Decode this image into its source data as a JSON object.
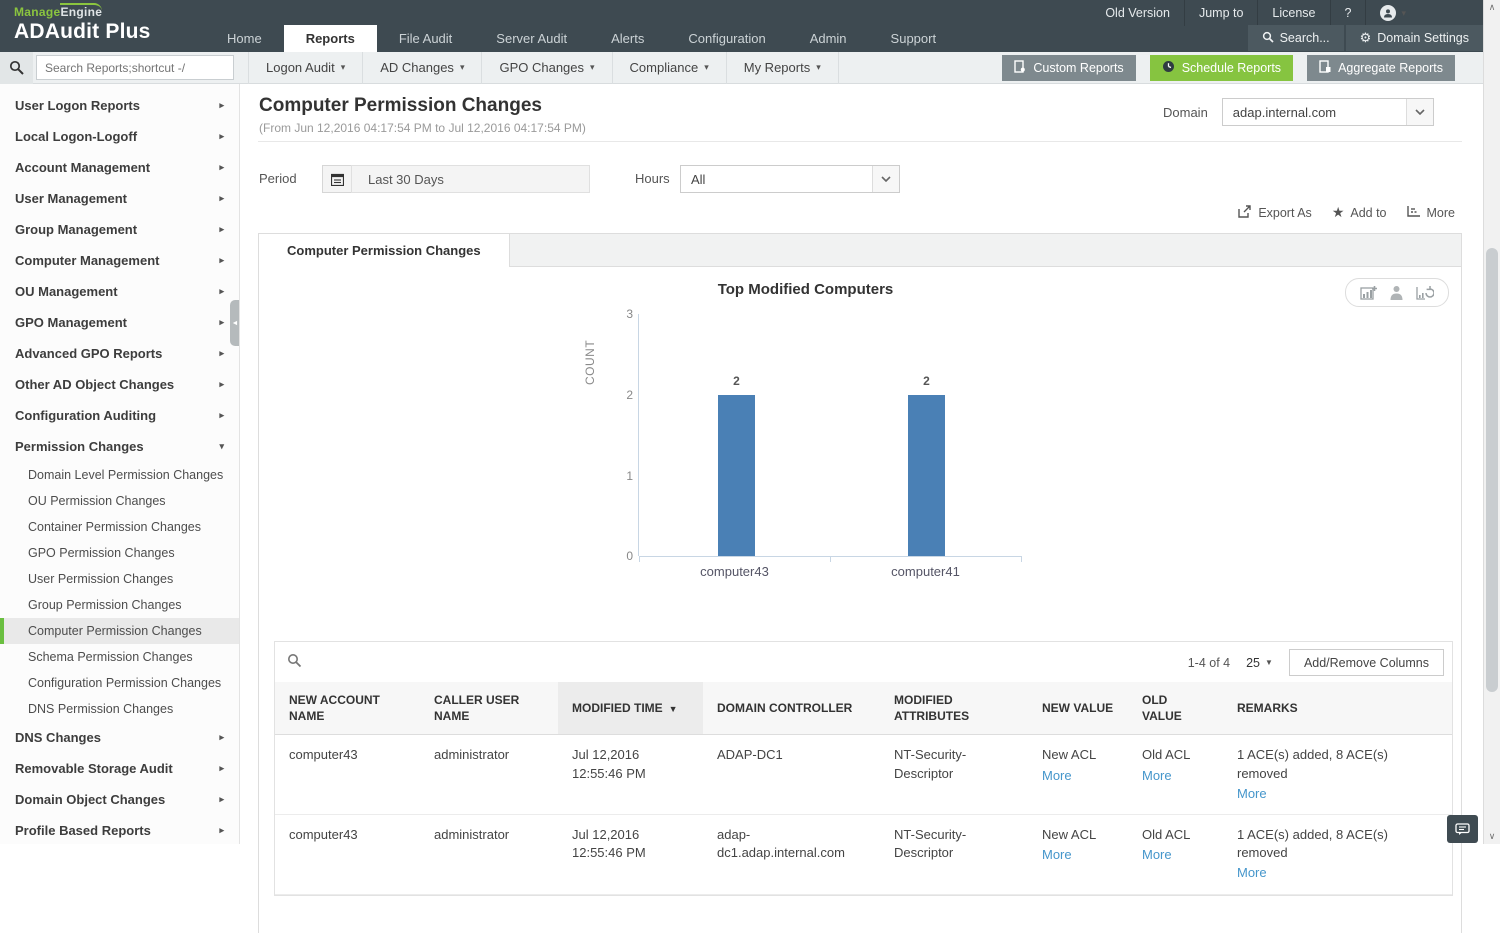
{
  "colors": {
    "header_bg": "#3e4a51",
    "accent_green": "#8bc53f",
    "button_green": "#86c440",
    "button_gray": "#7e898e",
    "bar_blue": "#4a80b5",
    "link_blue": "#4596cb",
    "selected_green": "#6abf40"
  },
  "icons": {
    "search": "magnifier-svg",
    "calendar": "calendar-svg",
    "gear": "⚙",
    "help": "?",
    "user": "person-svg",
    "clock": "clock-svg",
    "report_doc": "doc-svg",
    "export": "export-svg",
    "star": "★",
    "more_lines": "list-svg",
    "chart_add": "bars-plus-svg",
    "chart_person": "person-svg",
    "chart_refresh": "refresh-svg",
    "chat": "chat-bubble-svg",
    "caret_down": "▾",
    "arrow_right": "▸",
    "sort_desc": "▼",
    "scroll_up": "∧",
    "scroll_down": "∨",
    "collapse_left": "◄"
  },
  "header": {
    "brand_manage": "Manage",
    "brand_engine": "Engine",
    "product": "ADAudit Plus",
    "nav": [
      "Home",
      "Reports",
      "File Audit",
      "Server Audit",
      "Alerts",
      "Configuration",
      "Admin",
      "Support"
    ],
    "utility": [
      "Old Version",
      "Jump to",
      "License"
    ],
    "help": "?",
    "search_label": "Search...",
    "domain_settings_label": "Domain Settings"
  },
  "toolbar": {
    "search_placeholder": "Search Reports;shortcut -/",
    "menus": [
      "Logon Audit",
      "AD Changes",
      "GPO Changes",
      "Compliance",
      "My Reports"
    ],
    "buttons": [
      "Custom Reports",
      "Schedule Reports",
      "Aggregate Reports"
    ]
  },
  "sidebar": {
    "top_items": [
      "User Logon Reports",
      "Local Logon-Logoff",
      "Account Management",
      "User Management",
      "Group Management",
      "Computer Management",
      "OU Management",
      "GPO Management",
      "Advanced GPO Reports",
      "Other AD Object Changes",
      "Configuration Auditing"
    ],
    "expanded_item": "Permission Changes",
    "children": [
      "Domain Level Permission Changes",
      "OU Permission Changes",
      "Container Permission Changes",
      "GPO Permission Changes",
      "User Permission Changes",
      "Group Permission Changes",
      "Computer Permission Changes",
      "Schema Permission Changes",
      "Configuration Permission Changes",
      "DNS Permission Changes"
    ],
    "selected_child": "Computer Permission Changes",
    "bottom_items": [
      "DNS Changes",
      "Removable Storage Audit",
      "Domain Object Changes",
      "Profile Based Reports"
    ]
  },
  "report": {
    "title": "Computer Permission Changes",
    "date_range": "(From Jun 12,2016 04:17:54 PM to Jul 12,2016 04:17:54 PM)",
    "domain_label": "Domain",
    "domain_value": "adap.internal.com",
    "period_label": "Period",
    "period_value": "Last 30 Days",
    "hours_label": "Hours",
    "hours_value": "All",
    "export_label": "Export As",
    "add_to_label": "Add to",
    "more_label": "More",
    "tab_label": "Computer Permission Changes"
  },
  "chart_data": {
    "type": "bar",
    "title": "Top Modified Computers",
    "categories": [
      "computer43",
      "computer41"
    ],
    "values": [
      2,
      2
    ],
    "xlabel": "",
    "ylabel": "COUNT",
    "ylim": [
      0,
      3
    ],
    "yticks": [
      0,
      1,
      2,
      3
    ],
    "bar_color": "#4a80b5",
    "grid": false,
    "legend_position": "none"
  },
  "table": {
    "pagination_range": "1-4 of 4",
    "page_size": "25",
    "columns_button": "Add/Remove Columns",
    "headers": [
      "NEW ACCOUNT NAME",
      "CALLER USER NAME",
      "MODIFIED TIME",
      "DOMAIN CONTROLLER",
      "MODIFIED ATTRIBUTES",
      "NEW VALUE",
      "OLD VALUE",
      "REMARKS"
    ],
    "more_label": "More",
    "rows": [
      {
        "new_account_name": "computer43",
        "caller_user_name": "administrator",
        "modified_time": "Jul 12,2016 12:55:46 PM",
        "domain_controller": "ADAP-DC1",
        "modified_attributes": "NT-Security-Descriptor",
        "new_value": "New ACL",
        "old_value": "Old ACL",
        "remarks": "1 ACE(s) added, 8 ACE(s) removed"
      },
      {
        "new_account_name": "computer43",
        "caller_user_name": "administrator",
        "modified_time": "Jul 12,2016 12:55:46 PM",
        "domain_controller": "adap-dc1.adap.internal.com",
        "modified_attributes": "NT-Security-Descriptor",
        "new_value": "New ACL",
        "old_value": "Old ACL",
        "remarks": "1 ACE(s) added, 8 ACE(s) removed"
      }
    ]
  },
  "misc": {
    "caret_down": "▾",
    "arrow_right": "▸",
    "sort_arrow": "▼",
    "star": "★",
    "gear": "⚙",
    "scroll_up": "∧",
    "scroll_down": "∨",
    "collapse_left": "◄"
  }
}
